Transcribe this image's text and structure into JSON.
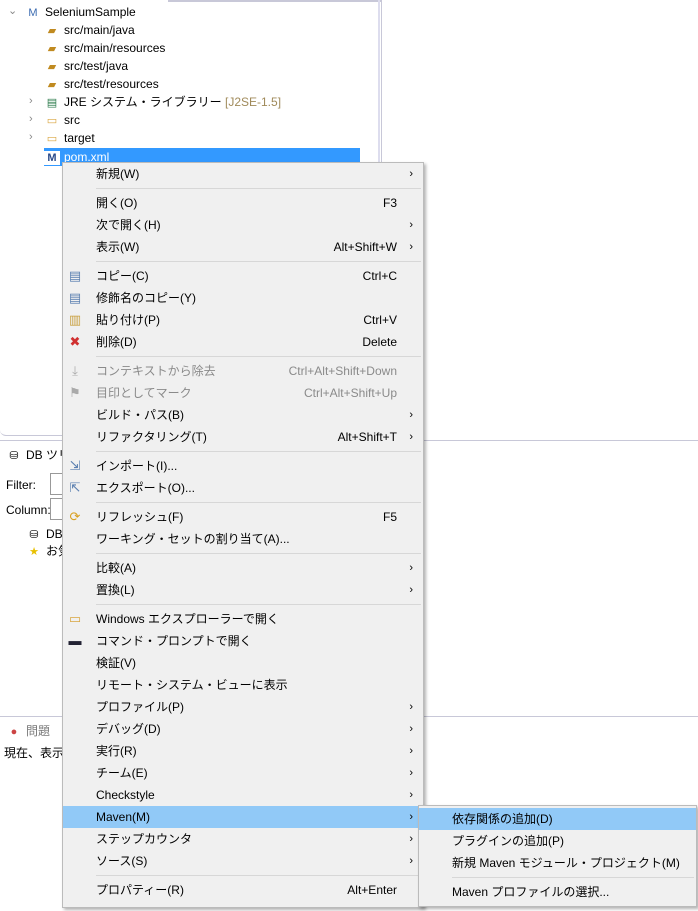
{
  "tree": {
    "project": "SeleniumSample",
    "items": [
      "src/main/java",
      "src/main/resources",
      "src/test/java",
      "src/test/resources"
    ],
    "jre": "JRE システム・ライブラリー",
    "jre_tag": "[J2SE-1.5]",
    "folders": [
      "src",
      "target"
    ],
    "selected": "pom.xml"
  },
  "db": {
    "title": "DB ツリー",
    "filter_label": "Filter:",
    "column_label": "Column:",
    "node1": "DB",
    "node2": "お気"
  },
  "problems": {
    "title": "問題",
    "status": "現在、表示"
  },
  "menu": [
    {
      "label": "新規(W)",
      "arrow": true
    },
    {
      "sep": true
    },
    {
      "label": "開く(O)",
      "shortcut": "F3"
    },
    {
      "label": "次で開く(H)",
      "arrow": true
    },
    {
      "label": "表示(W)",
      "shortcut": "Alt+Shift+W",
      "arrow": true
    },
    {
      "sep": true
    },
    {
      "label": "コピー(C)",
      "shortcut": "Ctrl+C",
      "icon": "copy"
    },
    {
      "label": "修飾名のコピー(Y)",
      "icon": "copy-qualified"
    },
    {
      "label": "貼り付け(P)",
      "shortcut": "Ctrl+V",
      "icon": "paste"
    },
    {
      "label": "削除(D)",
      "shortcut": "Delete",
      "icon": "delete"
    },
    {
      "sep": true
    },
    {
      "label": "コンテキストから除去",
      "shortcut": "Ctrl+Alt+Shift+Down",
      "icon": "remove-context",
      "disabled": true
    },
    {
      "label": "目印としてマーク",
      "shortcut": "Ctrl+Alt+Shift+Up",
      "icon": "mark",
      "disabled": true
    },
    {
      "label": "ビルド・パス(B)",
      "arrow": true
    },
    {
      "label": "リファクタリング(T)",
      "shortcut": "Alt+Shift+T",
      "arrow": true
    },
    {
      "sep": true
    },
    {
      "label": "インポート(I)...",
      "icon": "import"
    },
    {
      "label": "エクスポート(O)...",
      "icon": "export"
    },
    {
      "sep": true
    },
    {
      "label": "リフレッシュ(F)",
      "shortcut": "F5",
      "icon": "refresh"
    },
    {
      "label": "ワーキング・セットの割り当て(A)..."
    },
    {
      "sep": true
    },
    {
      "label": "比較(A)",
      "arrow": true
    },
    {
      "label": "置換(L)",
      "arrow": true
    },
    {
      "sep": true
    },
    {
      "label": "Windows エクスプローラーで開く",
      "icon": "explorer"
    },
    {
      "label": "コマンド・プロンプトで開く",
      "icon": "terminal"
    },
    {
      "label": "検証(V)"
    },
    {
      "label": "リモート・システム・ビューに表示"
    },
    {
      "label": "プロファイル(P)",
      "arrow": true
    },
    {
      "label": "デバッグ(D)",
      "arrow": true
    },
    {
      "label": "実行(R)",
      "arrow": true
    },
    {
      "label": "チーム(E)",
      "arrow": true
    },
    {
      "label": "Checkstyle",
      "arrow": true
    },
    {
      "label": "Maven(M)",
      "arrow": true,
      "highlight": true
    },
    {
      "label": "ステップカウンタ",
      "arrow": true
    },
    {
      "label": "ソース(S)",
      "arrow": true
    },
    {
      "sep": true
    },
    {
      "label": "プロパティー(R)",
      "shortcut": "Alt+Enter"
    }
  ],
  "submenu": [
    {
      "label": "依存関係の追加(D)",
      "highlight": true
    },
    {
      "label": "プラグインの追加(P)"
    },
    {
      "label": "新規 Maven モジュール・プロジェクト(M)"
    },
    {
      "sep": true
    },
    {
      "label": "Maven プロファイルの選択..."
    }
  ]
}
